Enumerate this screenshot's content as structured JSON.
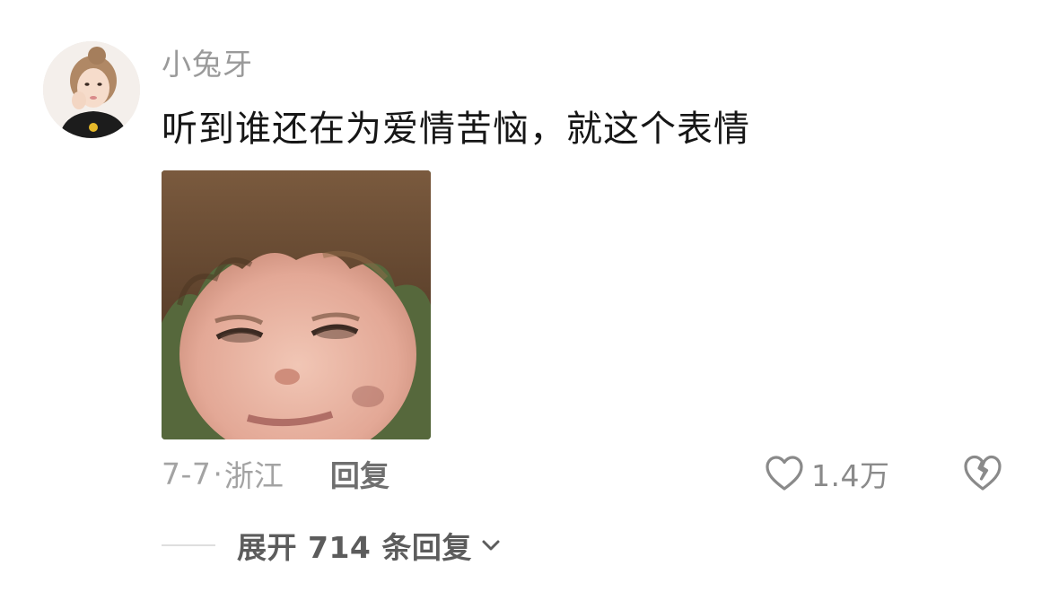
{
  "comment": {
    "username": "小兔牙",
    "text": "听到谁还在为爱情苦恼，就这个表情",
    "date": "7-7",
    "separator": "·",
    "location": "浙江",
    "reply_label": "回复",
    "like_count": "1.4万",
    "avatar_icon": "user-avatar",
    "sticker_icon": "meme-sticker-image"
  },
  "replies": {
    "expand_label": "展开 714 条回复",
    "chevron_icon": "chevron-down-icon"
  },
  "colors": {
    "username": "#9a9a9a",
    "text": "#161616",
    "meta": "#a3a3a3",
    "reply": "#6f6f6f",
    "icon": "#8a8a8a"
  }
}
